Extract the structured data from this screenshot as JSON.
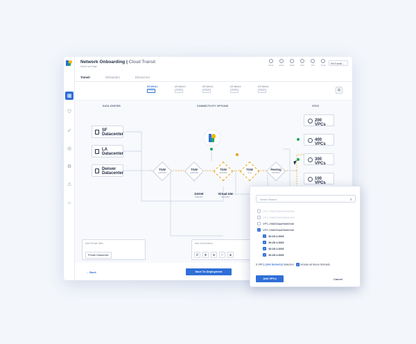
{
  "header": {
    "title": "Network Onboarding",
    "subtitle": "Cloud Transit",
    "instruction": "Select an Edge",
    "account": "PlixTransit"
  },
  "toolbar": [
    "Admin",
    "Alerts",
    "Tasks",
    "FAQ",
    "Diff",
    "Tools"
  ],
  "tabs": [
    "Transit",
    "Onboarded",
    "Discovered"
  ],
  "regions": [
    {
      "name": "US-West.1",
      "tag": "Transit"
    },
    {
      "name": "US-West.2",
      "tag": "Transit"
    },
    {
      "name": "US-West.3",
      "tag": "Transit"
    },
    {
      "name": "US-West.4",
      "tag": "Transit"
    },
    {
      "name": "US-West.5",
      "tag": "Transit"
    }
  ],
  "sections": {
    "left": "DATA CENTER",
    "middle": "CONNECTIVITY OPTIONS",
    "right": "VPCS"
  },
  "datacenters": [
    {
      "l1": "SF",
      "l2": "Datacenter"
    },
    {
      "l1": "LA",
      "l2": "Datacenter"
    },
    {
      "l1": "Denver",
      "l2": "Datacenter"
    }
  ],
  "nodes": [
    {
      "label": "TGW",
      "num": "9284024"
    },
    {
      "label": "TGW",
      "num": "9284185"
    },
    {
      "label": "TGW",
      "num": "9284082"
    },
    {
      "label": "TGW",
      "num": "New"
    },
    {
      "label": "Peering",
      "num": "9284551"
    },
    {
      "label": "DXGW",
      "num": "9284287"
    },
    {
      "label": "Virtual GW",
      "num": "9284280"
    }
  ],
  "vpcs": [
    {
      "label": "200 VPCs",
      "sub": ""
    },
    {
      "label": "400 VPCs",
      "sub": ""
    },
    {
      "label": "300 VPCs",
      "sub": ""
    },
    {
      "label": "100 VPCs",
      "sub": "Connected"
    }
  ],
  "private_sites": {
    "heading": "Add Private Sites",
    "item": "Private Datacenter"
  },
  "connections": {
    "heading": "Add Connections"
  },
  "footer": {
    "back": "Back",
    "deploy": "Save To Deployment"
  },
  "popup": {
    "search_placeholder": "Smart Search",
    "options": [
      {
        "text": "VPC-09883309a6f0dbd5c",
        "checked": false,
        "dim": true,
        "indent": false
      },
      {
        "text": "VPC-09883309a6f0dbd5c",
        "checked": false,
        "dim": true,
        "indent": false
      },
      {
        "text": "VPC-098833aaf96dfe5d0",
        "checked": false,
        "dim": false,
        "indent": false
      },
      {
        "text": "VPC-098833aaf96dfe5d0",
        "checked": true,
        "dim": false,
        "indent": false
      },
      {
        "text": "10.23.1.0/24",
        "checked": true,
        "dim": false,
        "indent": true
      },
      {
        "text": "10.20.1.0/24",
        "checked": true,
        "dim": false,
        "indent": true
      },
      {
        "text": "10.23.1.0/24",
        "checked": true,
        "dim": false,
        "indent": true
      },
      {
        "text": "10.20.1.0/24",
        "checked": true,
        "dim": false,
        "indent": true
      }
    ],
    "summary_count": "6",
    "summary_vpcs": "VPCs",
    "summary_subnets": "(343 Subnets)",
    "summary_selected": "Selected",
    "include_label": "Include all future Subnets",
    "add_button": "Add VPCs",
    "cancel_button": "Cancel"
  },
  "colors": {
    "accent": "#2f6fd8",
    "connected": "#1faa59",
    "selected": "#e3a21a"
  }
}
